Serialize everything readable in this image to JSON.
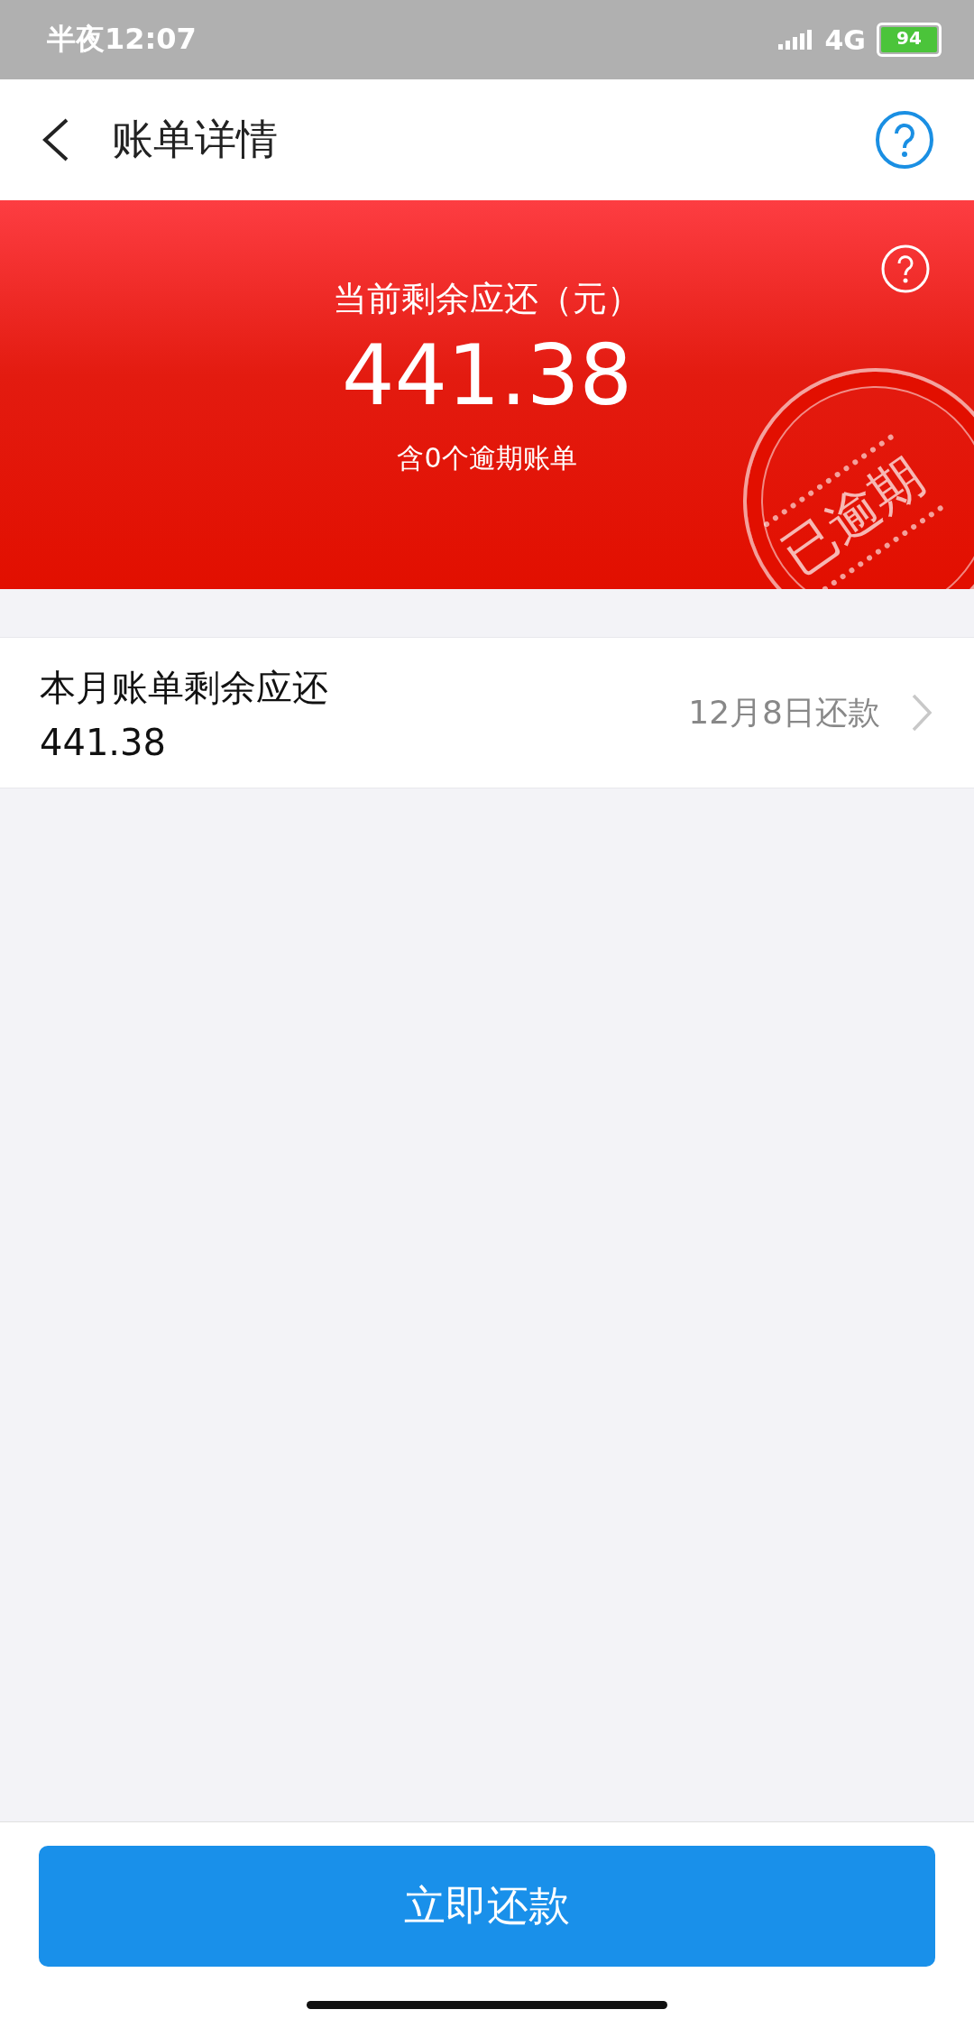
{
  "status_bar": {
    "time": "半夜12:07",
    "network": "4G",
    "battery": "94"
  },
  "header": {
    "title": "账单详情"
  },
  "summary": {
    "label": "当前剩余应还（元）",
    "amount": "441.38",
    "note": "含0个逾期账单",
    "stamp": "已逾期"
  },
  "bills": [
    {
      "title": "本月账单剩余应还",
      "amount": "441.38",
      "due": "12月8日还款"
    }
  ],
  "pay_button": "立即还款"
}
